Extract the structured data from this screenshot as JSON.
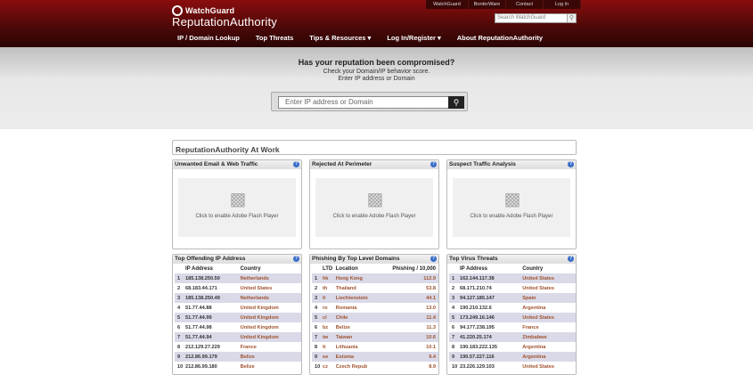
{
  "header": {
    "brand_top": "WatchGuard",
    "brand_name": "ReputationAuthority",
    "top_links": [
      "WatchGuard",
      "BorderWare",
      "Contact",
      "Log In"
    ],
    "search_placeholder": "Search WatchGuard",
    "nav": [
      "IP / Domain Lookup",
      "Top Threats",
      "Tips & Resources ▾",
      "Log In/Register ▾",
      "About ReputationAuthority"
    ]
  },
  "hero": {
    "title": "Has your reputation been compromised?",
    "line1": "Check your Domain/IP behavior score.",
    "line2": "Enter IP address or Domain",
    "input_placeholder": "Enter IP address or Domain"
  },
  "section_title": "ReputationAuthority At Work",
  "flash_panels": [
    {
      "title": "Unwanted Email & Web Traffic",
      "text": "Click to enable Adobe Flash Player"
    },
    {
      "title": "Rejected At Perimeter",
      "text": "Click to enable Adobe Flash Player"
    },
    {
      "title": "Suspect Traffic Analysis",
      "text": "Click to enable Adobe Flash Player"
    }
  ],
  "offending": {
    "title": "Top Offending IP Address",
    "headers": [
      "",
      "IP Address",
      "Country"
    ],
    "rows": [
      [
        "1",
        "185.138.250.50",
        "Netherlands"
      ],
      [
        "2",
        "68.183.44.171",
        "United States"
      ],
      [
        "3",
        "185.138.250.49",
        "Netherlands"
      ],
      [
        "4",
        "51.77.44.88",
        "United Kingdom"
      ],
      [
        "5",
        "51.77.44.99",
        "United Kingdom"
      ],
      [
        "6",
        "51.77.44.98",
        "United Kingdom"
      ],
      [
        "7",
        "51.77.44.94",
        "United Kingdom"
      ],
      [
        "8",
        "212.129.27.229",
        "France"
      ],
      [
        "9",
        "212.86.99.179",
        "Belize"
      ],
      [
        "10",
        "212.86.99.180",
        "Belize"
      ]
    ]
  },
  "phishing": {
    "title": "Phishing By Top Level Domains",
    "headers": [
      "",
      "LTD",
      "Location",
      "Phishing / 10,000"
    ],
    "rows": [
      [
        "1",
        "hk",
        "Hong Kong",
        "112.9"
      ],
      [
        "2",
        "th",
        "Thailand",
        "53.8"
      ],
      [
        "3",
        "li",
        "Liechtenstein",
        "44.1"
      ],
      [
        "4",
        "ro",
        "Romania",
        "13.0"
      ],
      [
        "5",
        "cl",
        "Chile",
        "11.4"
      ],
      [
        "6",
        "bz",
        "Belize",
        "11.3"
      ],
      [
        "7",
        "tw",
        "Taiwan",
        "10.6"
      ],
      [
        "8",
        "lt",
        "Lithuania",
        "10.1"
      ],
      [
        "9",
        "ee",
        "Estonia",
        "9.4"
      ],
      [
        "10",
        "cz",
        "Czech Repub",
        "8.9"
      ]
    ]
  },
  "virus": {
    "title": "Top Virus Threats",
    "headers": [
      "",
      "IP Address",
      "Country"
    ],
    "rows": [
      [
        "1",
        "162.144.117.38",
        "United States"
      ],
      [
        "2",
        "68.171.210.74",
        "United States"
      ],
      [
        "3",
        "94.127.185.147",
        "Spain"
      ],
      [
        "4",
        "190.210.132.6",
        "Argentina"
      ],
      [
        "5",
        "173.249.16.146",
        "United States"
      ],
      [
        "6",
        "94.177.238.195",
        "France"
      ],
      [
        "7",
        "41.220.25.174",
        "Zimbabwe"
      ],
      [
        "8",
        "190.183.222.135",
        "Argentina"
      ],
      [
        "9",
        "190.57.227.116",
        "Argentina"
      ],
      [
        "10",
        "23.226.129.103",
        "United States"
      ]
    ]
  }
}
